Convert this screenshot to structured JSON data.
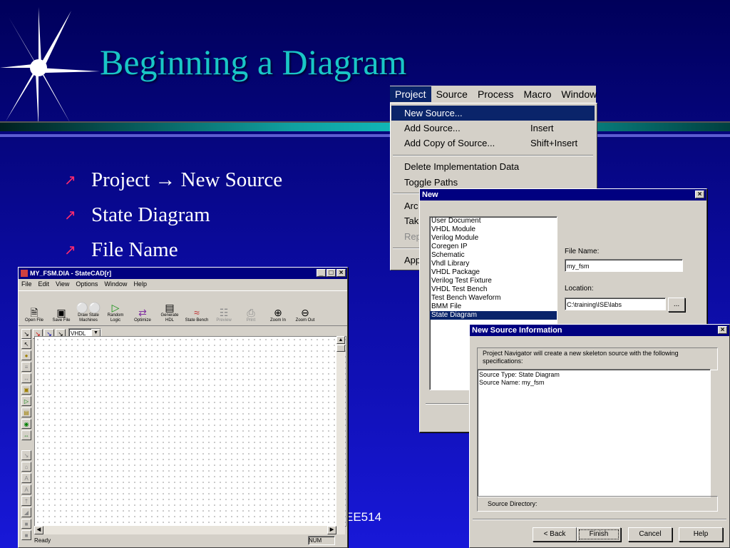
{
  "slide": {
    "title": "Beginning a Diagram",
    "bullets": [
      "Project → New Source",
      "State Diagram",
      "File Name"
    ],
    "footer": "EE514",
    "colors": {
      "title": "#19c6c6",
      "bullet_marker": "#ff2a6e",
      "background_top": "#00005a",
      "background_bottom": "#1818d8"
    }
  },
  "statecad": {
    "title": "MY_FSM.DIA - StateCAD[r]",
    "menu": [
      "File",
      "Edit",
      "View",
      "Options",
      "Window",
      "Help"
    ],
    "toolbar": [
      {
        "label": "Open File",
        "icon": "document-icon",
        "enabled": true
      },
      {
        "label": "Save File",
        "icon": "floppy-icon",
        "enabled": true
      },
      {
        "label": "Draw State Machines",
        "icon": "state-machine-icon",
        "enabled": true
      },
      {
        "label": "Random Logic",
        "icon": "logic-icon",
        "enabled": true
      },
      {
        "label": "Optimize",
        "icon": "optimize-icon",
        "enabled": true
      },
      {
        "label": "Generate HDL",
        "icon": "hdl-icon",
        "enabled": true
      },
      {
        "label": "State Bench",
        "icon": "waveform-icon",
        "enabled": true
      },
      {
        "label": "Preview",
        "icon": "preview-icon",
        "enabled": false
      },
      {
        "label": "Print",
        "icon": "printer-icon",
        "enabled": false
      },
      {
        "label": "Zoom In",
        "icon": "zoom-in-icon",
        "enabled": true
      },
      {
        "label": "Zoom Out",
        "icon": "zoom-out-icon",
        "enabled": true
      }
    ],
    "language_select": "VHDL",
    "status": {
      "left": "Ready",
      "num": "NUM"
    }
  },
  "project_menu": {
    "menubar": [
      "Project",
      "Source",
      "Process",
      "Macro",
      "Window"
    ],
    "items": [
      {
        "label": "New Source...",
        "shortcut": ""
      },
      {
        "label": "Add Source...",
        "shortcut": "Insert"
      },
      {
        "label": "Add Copy of Source...",
        "shortcut": "Shift+Insert"
      },
      {
        "label": "Delete Implementation Data",
        "shortcut": ""
      },
      {
        "label": "Toggle Paths",
        "shortcut": ""
      },
      {
        "label": "Arc",
        "shortcut": ""
      },
      {
        "label": "Tak",
        "shortcut": ""
      },
      {
        "label": "Rep",
        "shortcut": ""
      },
      {
        "label": "App",
        "shortcut": ""
      }
    ]
  },
  "new_dialog": {
    "title": "New",
    "types": [
      "User Document",
      "VHDL Module",
      "Verilog Module",
      "Coregen IP",
      "Schematic",
      "Vhdl Library",
      "VHDL Package",
      "Verilog Test Fixture",
      "VHDL Test Bench",
      "Test Bench Waveform",
      "BMM File",
      "State Diagram"
    ],
    "selected_type": "State Diagram",
    "file_name_label": "File Name:",
    "file_name_value": "my_fsm",
    "location_label": "Location:",
    "location_value": "C:\\training\\ISE\\labs",
    "browse_label": "..."
  },
  "info_dialog": {
    "title": "New Source Information",
    "description": "Project Navigator will create a new skeleton source with the following specifications:",
    "source_type_line": "Source Type:  State Diagram",
    "source_name_line": "Source Name:  my_fsm",
    "directory_label": "Source Directory:",
    "buttons": {
      "back": "< Back",
      "finish": "Finish",
      "cancel": "Cancel",
      "help": "Help"
    }
  }
}
